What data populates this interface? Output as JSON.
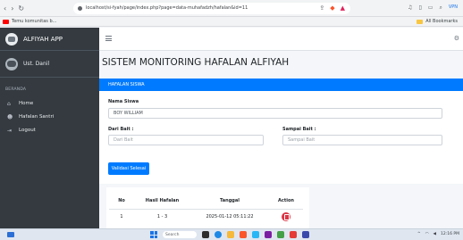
{
  "browser": {
    "url": "localhost/si-fyah/page/index.php?page=data-muhafadzh/hafalan&id=11",
    "bookmark_left": "Temu komunitas b...",
    "bookmark_right": "All Bookmarks",
    "vpn_label": "VPN"
  },
  "sidebar": {
    "brand": "ALFIYAH APP",
    "user_name": "Ust. Danil",
    "section_header": "BERANDA",
    "items": [
      {
        "icon": "home-icon",
        "label": "Home"
      },
      {
        "icon": "users-icon",
        "label": "Hafalan Santri"
      },
      {
        "icon": "logout-icon",
        "label": "Logout"
      }
    ]
  },
  "main": {
    "page_title": "SISTEM MONITORING HAFALAN ALFIYAH",
    "card_header": "HAFALAN SISWA",
    "nama_label": "Nama Siswa",
    "nama_value": "BOY WILLIAM",
    "dari_label": "Dari Bait :",
    "dari_placeholder": "Dari Bait",
    "sampai_label": "Sampai Bait :",
    "sampai_placeholder": "Sampai Bait",
    "validasi_button": "Validasi Selesai"
  },
  "table": {
    "headers": [
      "No",
      "Hasil Hafalan",
      "Tanggal",
      "Action"
    ],
    "rows": [
      {
        "no": "1",
        "hasil": "1 - 3",
        "tanggal": "2025-01-12 05:11:22"
      }
    ]
  },
  "taskbar": {
    "search_placeholder": "Search",
    "time": "12:16 PM"
  },
  "colors": {
    "primary": "#007bff",
    "sidebar_bg": "#343a40",
    "danger": "#dc3545"
  }
}
